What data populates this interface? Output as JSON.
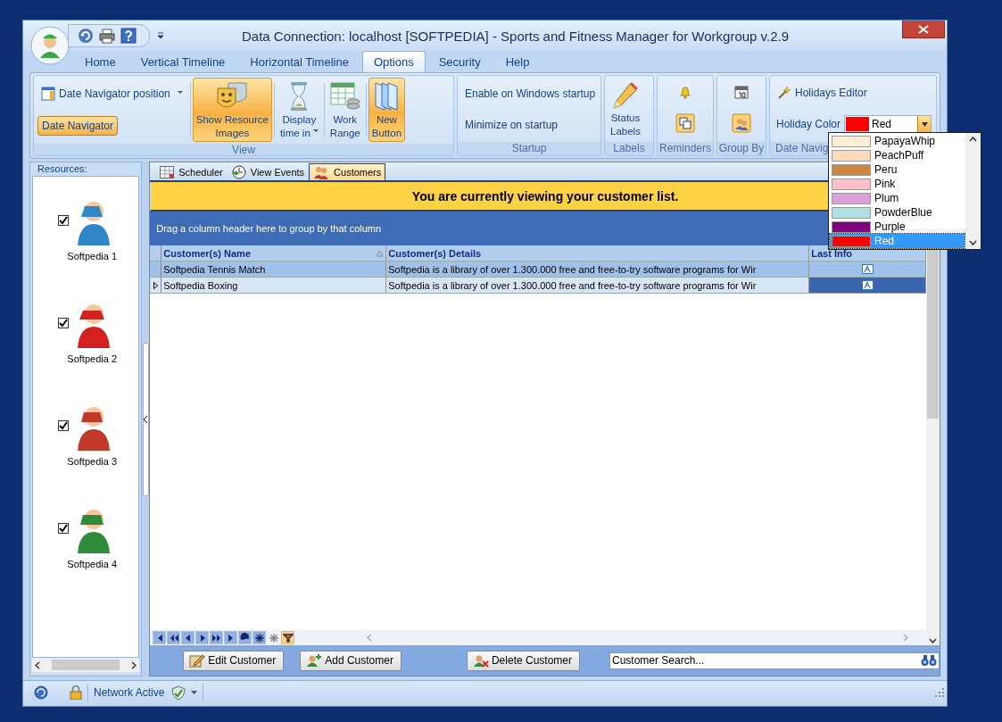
{
  "window": {
    "title": "Data Connection: localhost [SOFTPEDIA] - Sports and Fitness Manager for Workgroup v.2.9"
  },
  "ribbon_tabs": [
    {
      "label": "Home",
      "selected": false
    },
    {
      "label": "Vertical Timeline",
      "selected": false
    },
    {
      "label": "Horizontal Timeline",
      "selected": false
    },
    {
      "label": "Options",
      "selected": true
    },
    {
      "label": "Security",
      "selected": false
    },
    {
      "label": "Help",
      "selected": false
    }
  ],
  "ribbon": {
    "view": {
      "label": "View",
      "date_navigator_position": "Date Navigator position",
      "date_navigator": {
        "label": "Date Navigator",
        "selected": true
      },
      "buttons": [
        {
          "label": "Show Resource\nImages",
          "selected": true,
          "dropdown": false
        },
        {
          "label": "Display\ntime in",
          "selected": false,
          "dropdown": true
        },
        {
          "label": "Work\nRange",
          "selected": false,
          "dropdown": false
        },
        {
          "label": "New\nButton",
          "selected": true,
          "dropdown": false
        }
      ]
    },
    "startup": {
      "label": "Startup",
      "items": [
        "Enable on Windows startup",
        "Minimize on startup"
      ]
    },
    "labels": {
      "label": "Labels",
      "button": "Status\nLabels"
    },
    "reminders": {
      "label": "Reminders"
    },
    "group_by": {
      "label": "Group By"
    },
    "date_navigator": {
      "label": "Date Navig",
      "holidays_editor": "Holidays Editor",
      "holiday_color": {
        "label": "Holiday Color",
        "value": "Red",
        "color": "#ff0000"
      }
    }
  },
  "color_dropdown": {
    "options": [
      {
        "label": "PapayaWhip",
        "color": "#ffefd5",
        "selected": false
      },
      {
        "label": "PeachPuff",
        "color": "#ffdab9",
        "selected": false
      },
      {
        "label": "Peru",
        "color": "#cd853f",
        "selected": false
      },
      {
        "label": "Pink",
        "color": "#ffc0cb",
        "selected": false
      },
      {
        "label": "Plum",
        "color": "#dda0dd",
        "selected": false
      },
      {
        "label": "PowderBlue",
        "color": "#b0e0e6",
        "selected": false
      },
      {
        "label": "Purple",
        "color": "#800080",
        "selected": false
      },
      {
        "label": "Red",
        "color": "#ff0000",
        "selected": true
      }
    ]
  },
  "resources": {
    "title": "Resources:",
    "items": [
      {
        "name": "Softpedia 1",
        "checked": true
      },
      {
        "name": "Softpedia 2",
        "checked": true
      },
      {
        "name": "Softpedia 3",
        "checked": true
      },
      {
        "name": "Softpedia 4",
        "checked": true
      }
    ]
  },
  "document_tabs": [
    {
      "label": "Scheduler",
      "selected": false
    },
    {
      "label": "View Events",
      "selected": false
    },
    {
      "label": "Customers",
      "selected": true
    }
  ],
  "banner": "You are currently viewing your customer list.",
  "group_panel": "Drag a column header here to group by that column",
  "grid": {
    "columns": [
      "Customer(s) Name",
      "Customer(s) Details",
      "Last Info"
    ],
    "rows": [
      {
        "name": "Softpedia Tennis Match",
        "details": "Softpedia is a library of over 1.300.000 free and free-to-try software programs for Wir",
        "selected": false
      },
      {
        "name": "Softpedia Boxing",
        "details": "Softpedia is a library of over 1.300.000 free and free-to-try software programs for Wir",
        "selected": true
      }
    ]
  },
  "actions": [
    "Edit Customer",
    "Add Customer",
    "Delete Customer"
  ],
  "search": {
    "value": "Customer Search..."
  },
  "status_bar": {
    "text": "Network Active"
  }
}
